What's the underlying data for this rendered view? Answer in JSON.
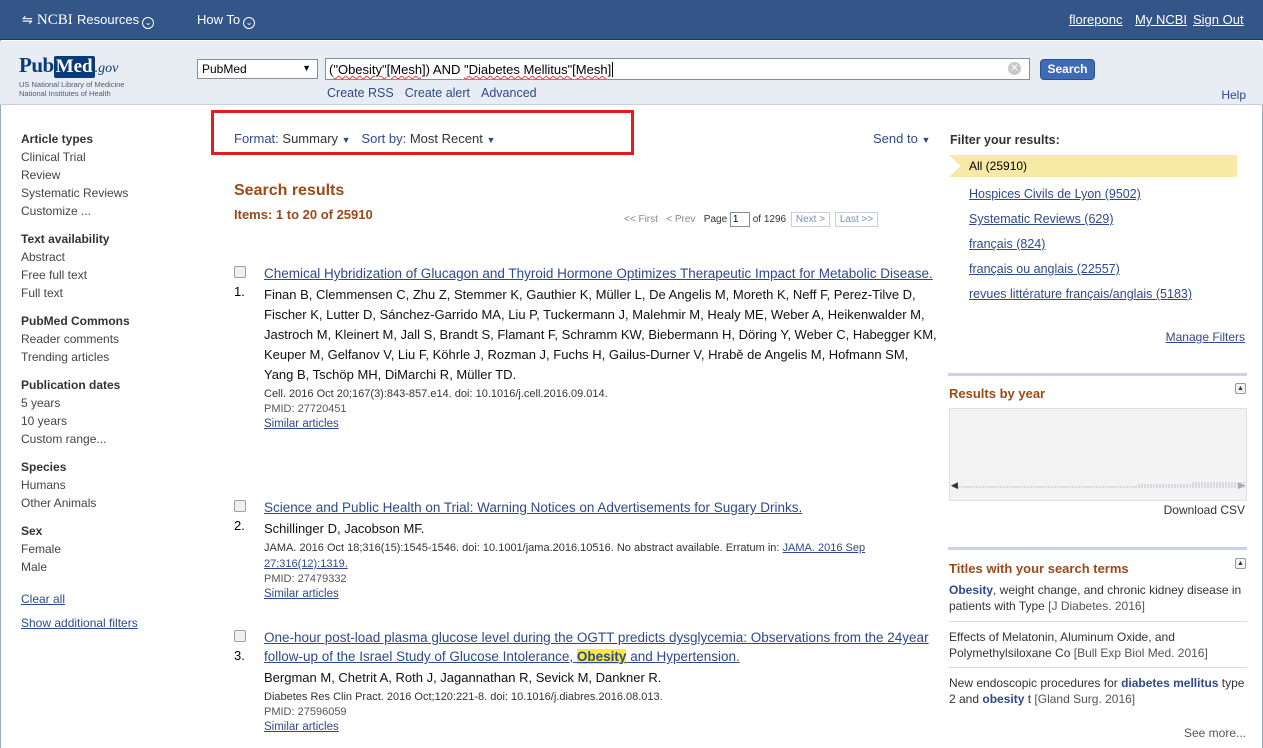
{
  "ncbi_bar": {
    "logo": "NCBI",
    "resources": "Resources",
    "howto": "How To",
    "user": "floreponc",
    "mync": "My NCBI",
    "signout": "Sign Out"
  },
  "search": {
    "logo_pub": "Pub",
    "logo_med": "Med",
    "logo_gov": ".gov",
    "logo_sub1": "US National Library of Medicine",
    "logo_sub2": "National Institutes of Health",
    "db": "PubMed",
    "query_pre": "(",
    "query_t1": "\"Obesity\"[Mesh]",
    "query_mid": ") AND ",
    "query_t2": "\"Diabetes Mellitus\"[Mesh]",
    "query_post": "",
    "button": "Search",
    "create_rss": "Create RSS",
    "create_alert": "Create alert",
    "advanced": "Advanced",
    "help": "Help"
  },
  "sidebar": {
    "groups": [
      {
        "head": "Article types",
        "items": [
          "Clinical Trial",
          "Review",
          "Systematic Reviews",
          "Customize ..."
        ]
      },
      {
        "head": "Text availability",
        "items": [
          "Abstract",
          "Free full text",
          "Full text"
        ]
      },
      {
        "head": "PubMed Commons",
        "items": [
          "Reader comments",
          "Trending articles"
        ]
      },
      {
        "head": "Publication dates",
        "items": [
          "5 years",
          "10 years",
          "Custom range..."
        ]
      },
      {
        "head": "Species",
        "items": [
          "Humans",
          "Other Animals"
        ]
      },
      {
        "head": "Sex",
        "items": [
          "Female",
          "Male"
        ]
      }
    ],
    "clear_all": "Clear all",
    "show_more": "Show additional filters"
  },
  "toolbar": {
    "format_label": "Format",
    "format_value": "Summary",
    "sort_label": "Sort by",
    "sort_value": "Most Recent",
    "send_to": "Send to"
  },
  "results": {
    "heading": "Search results",
    "items": "Items: 1 to 20 of 25910",
    "pager": {
      "first": "<< First",
      "prev": "< Prev",
      "page_label": "Page",
      "page": "1",
      "of": "of 1296",
      "next": "Next >",
      "last": "Last >>"
    },
    "list": [
      {
        "num": "1.",
        "title": "Chemical Hybridization of Glucagon and Thyroid Hormone Optimizes Therapeutic Impact for Metabolic Disease.",
        "authors": "Finan B, Clemmensen C, Zhu Z, Stemmer K, Gauthier K, Müller L, De Angelis M, Moreth K, Neff F, Perez-Tilve D, Fischer K, Lutter D, Sánchez-Garrido MA, Liu P, Tuckermann J, Malehmir M, Healy ME, Weber A, Heikenwalder M, Jastroch M, Kleinert M, Jall S, Brandt S, Flamant F, Schramm KW, Biebermann H, Döring Y, Weber C, Habegger KM, Keuper M, Gelfanov V, Liu F, Köhrle J, Rozman J, Fuchs H, Gailus-Durner V, Hrabě de Angelis M, Hofmann SM, Yang B, Tschöp MH, DiMarchi R, Müller TD.",
        "source": "Cell. 2016 Oct 20;167(3):843-857.e14. doi: 10.1016/j.cell.2016.09.014.",
        "pmid": "PMID: 27720451",
        "similar": "Similar articles"
      },
      {
        "num": "2.",
        "title": "Science and Public Health on Trial: Warning Notices on Advertisements for Sugary Drinks.",
        "authors": "Schillinger D, Jacobson MF.",
        "source": "JAMA. 2016 Oct 18;316(15):1545-1546. doi: 10.1001/jama.2016.10516. No abstract available. Erratum in: ",
        "erratum": "JAMA. 2016 Sep 27;316(12):1319.",
        "pmid": "PMID: 27479332",
        "similar": "Similar articles"
      },
      {
        "num": "3.",
        "title_pre": "One-hour post-load plasma glucose level during the OGTT predicts dysglycemia: Observations from the 24year follow-up of the Israel Study of Glucose Intolerance, ",
        "title_hl": "Obesity",
        "title_post": " and Hypertension.",
        "authors": "Bergman M, Chetrit A, Roth J, Jagannathan R, Sevick M, Dankner R.",
        "source": "Diabetes Res Clin Pract. 2016 Oct;120:221-8. doi: 10.1016/j.diabres.2016.08.013.",
        "pmid": "PMID: 27596059",
        "similar": "Similar articles"
      }
    ]
  },
  "filters": {
    "heading": "Filter your results:",
    "all": "All (25910)",
    "items": [
      "Hospices Civils de Lyon (9502)",
      "Systematic Reviews (629)",
      "français (824)",
      "français ou anglais (22557)",
      "revues littérature français/anglais (5183)"
    ],
    "manage": "Manage Filters"
  },
  "results_by_year": {
    "title": "Results by year",
    "download": "Download CSV"
  },
  "titles_panel": {
    "title": "Titles with your search terms",
    "items": [
      {
        "b1": "Obesity",
        "t1": ", weight change, and chronic kidney disease in patients with Type ",
        "j": "[J Diabetes. 2016]"
      },
      {
        "t1": "Effects of Melatonin, Aluminum Oxide, and Polymethylsiloxane Co ",
        "j": "[Bull Exp Biol Med. 2016]"
      },
      {
        "t1": "New endoscopic procedures for ",
        "b1": "diabetes mellitus",
        "t2": " type 2 and ",
        "b2": "obesity",
        "t3": " t ",
        "j": "[Gland Surg. 2016]"
      }
    ],
    "see_more": "See more..."
  },
  "colors": {
    "ncbi_bar": "#345588",
    "accent_brown": "#9b4a18",
    "link": "#2f4a8a",
    "highlight": "#fce93a",
    "red_box": "#e41c1c"
  }
}
